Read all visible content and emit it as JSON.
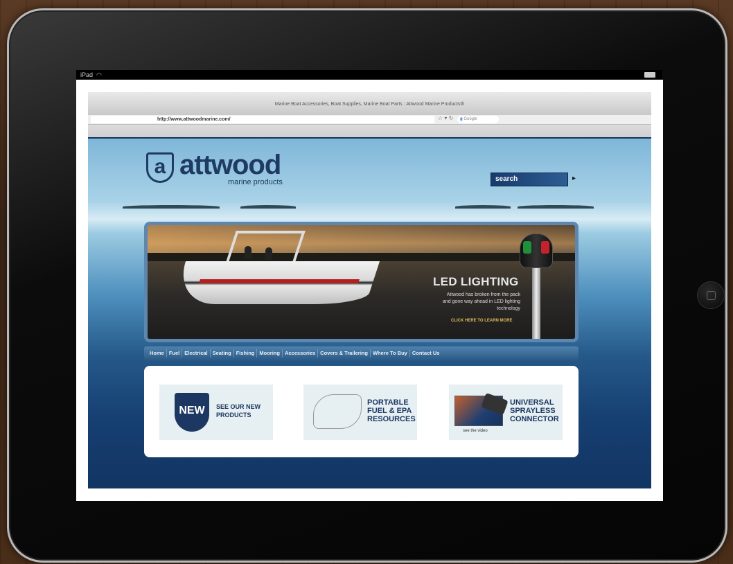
{
  "device": {
    "carrier": "iPad",
    "wifi_icon": "wifi-icon"
  },
  "browser": {
    "window_title": "Marine Boat Accessories, Boat Supplies, Marine Boat Parts : Attwood Marine Productsth",
    "url": "http://www.attwoodmarine.com/",
    "search_engine_label": "Google"
  },
  "site": {
    "logo": {
      "mark": "a",
      "name": "attwood",
      "tagline": "marine products"
    },
    "search": {
      "label": "search",
      "arrow": "▸"
    },
    "banner": {
      "title": "LED LIGHTING",
      "description": "Attwood has broken from the pack and gone way ahead in LED lighting technology",
      "cta": "CLICK HERE TO LEARN MORE"
    },
    "nav": [
      "Home",
      "Fuel",
      "Electrical",
      "Seating",
      "Fishing",
      "Mooring",
      "Accessories",
      "Covers & Trailering",
      "Where To Buy",
      "Contact Us"
    ],
    "promos": {
      "new_badge": "NEW",
      "new_text": "SEE OUR NEW PRODUCTS",
      "fuel_text": "PORTABLE FUEL & EPA RESOURCES",
      "connector_text": "UNIVERSAL SPRAYLESS CONNECTOR",
      "video_caption": "see the video"
    }
  },
  "colors": {
    "brand_navy": "#1d3763",
    "nav_blue": "#2b5985",
    "sky": "#a9d2e8"
  }
}
